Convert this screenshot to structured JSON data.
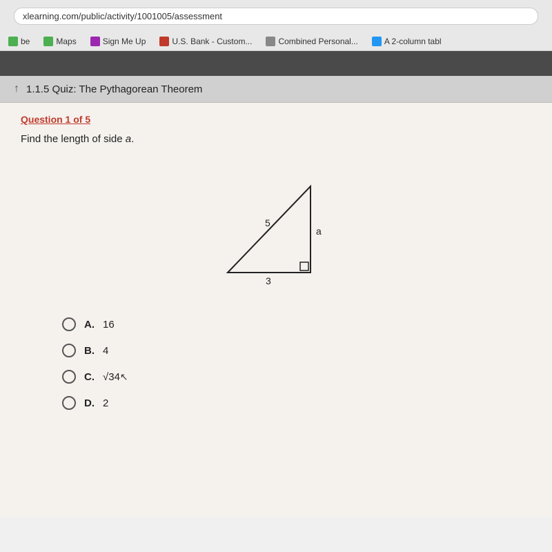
{
  "browser": {
    "address": "xlearning.com/public/activity/1001005/assessment",
    "bookmarks": [
      {
        "id": "be",
        "label": "be",
        "iconClass": "icon-maps"
      },
      {
        "id": "maps",
        "label": "Maps",
        "iconClass": "icon-maps"
      },
      {
        "id": "signup",
        "label": "Sign Me Up",
        "iconClass": "icon-signup"
      },
      {
        "id": "usbank",
        "label": "U.S. Bank - Custom...",
        "iconClass": "icon-usbank"
      },
      {
        "id": "combined",
        "label": "Combined Personal...",
        "iconClass": "icon-combined"
      },
      {
        "id": "table",
        "label": "A 2-column tabl",
        "iconClass": "icon-table"
      }
    ]
  },
  "quiz": {
    "title": "1.1.5 Quiz: The Pythagorean Theorem",
    "question_label": "Question 1 of 5",
    "question_text": "Find the length of side ",
    "question_var": "a",
    "triangle": {
      "hypotenuse_label": "5",
      "vertical_label": "a",
      "base_label": "3"
    },
    "answers": [
      {
        "id": "A",
        "label": "A.",
        "value": "16"
      },
      {
        "id": "B",
        "label": "B.",
        "value": "4"
      },
      {
        "id": "C",
        "label": "C.",
        "value": "√34",
        "is_sqrt": true,
        "sqrt_num": "34"
      },
      {
        "id": "D",
        "label": "D.",
        "value": "2"
      }
    ]
  }
}
